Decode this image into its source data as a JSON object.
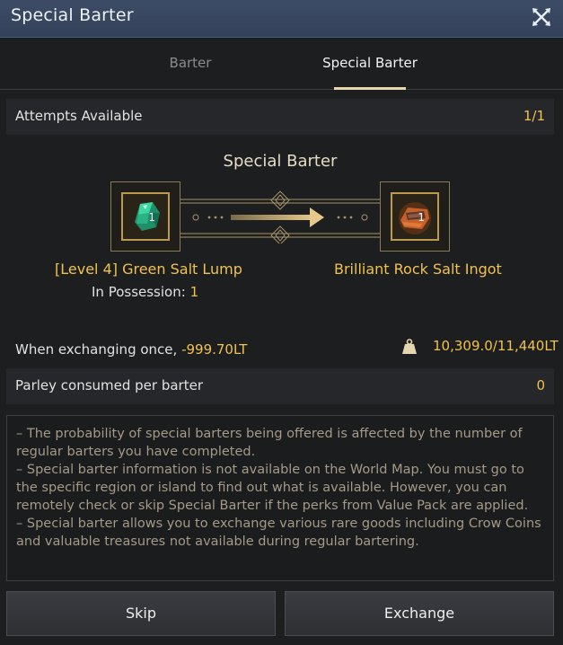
{
  "window": {
    "title": "Special Barter"
  },
  "tabs": [
    {
      "label": "Barter",
      "active": false
    },
    {
      "label": "Special Barter",
      "active": true
    }
  ],
  "attempts": {
    "label": "Attempts Available",
    "value": "1/1"
  },
  "section_title": "Special Barter",
  "give_item": {
    "name": "[Level 4] Green Salt Lump",
    "quantity": "1",
    "possession_label": "In Possession:",
    "possession_count": "1",
    "icon": "green-salt-lump-icon"
  },
  "receive_item": {
    "name": "Brilliant Rock Salt Ingot",
    "quantity": "1",
    "icon": "rock-salt-ingot-icon"
  },
  "exchange": {
    "label": "When exchanging once,",
    "cost": "-999.70LT",
    "weight": "10,309.0/11,440LT",
    "weight_icon": "weight-icon"
  },
  "parley": {
    "label": "Parley consumed per barter",
    "value": "0"
  },
  "notes": [
    "– The probability of special barters being offered is affected by the number of regular barters you have completed.",
    "– Special barter information is not available on the World Map. You must go to the specific region or island to find out what is available. However, you can remotely check or skip Special Barter if the perks from Value Pack are applied.",
    "– Special barter allows you to exchange various rare goods including Crow Coins and valuable treasures not available during regular bartering."
  ],
  "buttons": {
    "skip": "Skip",
    "exchange": "Exchange"
  },
  "colors": {
    "accent_gold": "#f0c24f",
    "title_bar": "#3a4862",
    "tab_underline": "#e8d7ad",
    "note_text": "#a59a86"
  }
}
